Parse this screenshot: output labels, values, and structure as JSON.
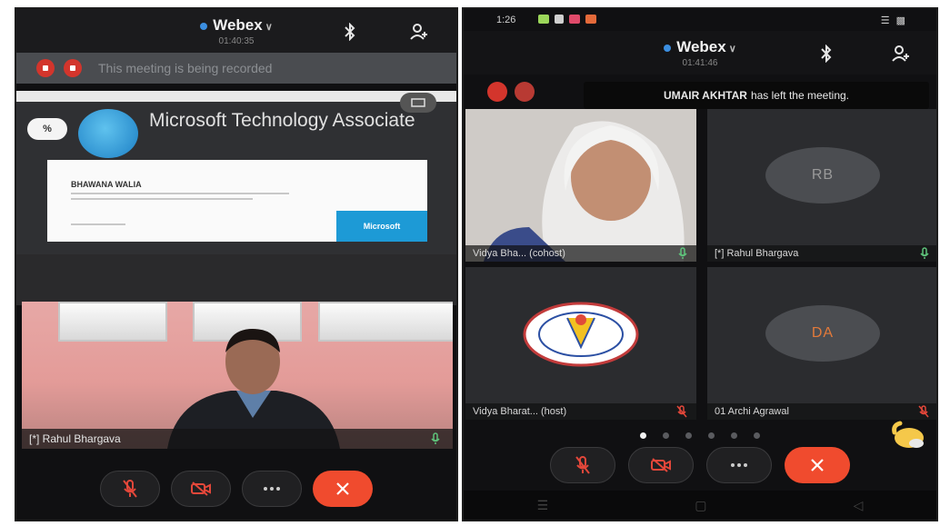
{
  "left_screen": {
    "app_title": "Webex",
    "meeting_time": "01:40:35",
    "recording_banner": "This meeting is being recorded",
    "shared_content": {
      "badge": "%",
      "title": "Microsoft Technology Associate",
      "certificate_name": "BHAWANA WALIA",
      "certificate_brand": "Microsoft"
    },
    "video_name": "[*] Rahul Bhargava"
  },
  "right_screen": {
    "status_time": "1:26",
    "app_title": "Webex",
    "meeting_time": "01:41:46",
    "toast": {
      "name": "UMAIR AKHTAR",
      "message": "has left the meeting."
    },
    "tiles": [
      {
        "label": "Vidya Bha... (cohost)"
      },
      {
        "label": "[*] Rahul Bhargava",
        "initials": "RB"
      },
      {
        "label": "Vidya Bharat... (host)"
      },
      {
        "label": "01 Archi Agrawal",
        "initials": "DA"
      }
    ],
    "page_dots": 6,
    "active_dot": 0
  },
  "icons": {
    "bluetooth": "bluetooth-icon",
    "participants": "participants-icon",
    "mute": "mic-muted-icon",
    "video": "video-off-icon",
    "more": "more-icon",
    "end": "end-call-icon",
    "wave": "hand-wave-icon"
  },
  "colors": {
    "end_call": "#f04b2e",
    "record": "#d3352c",
    "webex_blue": "#3b8ee0"
  }
}
